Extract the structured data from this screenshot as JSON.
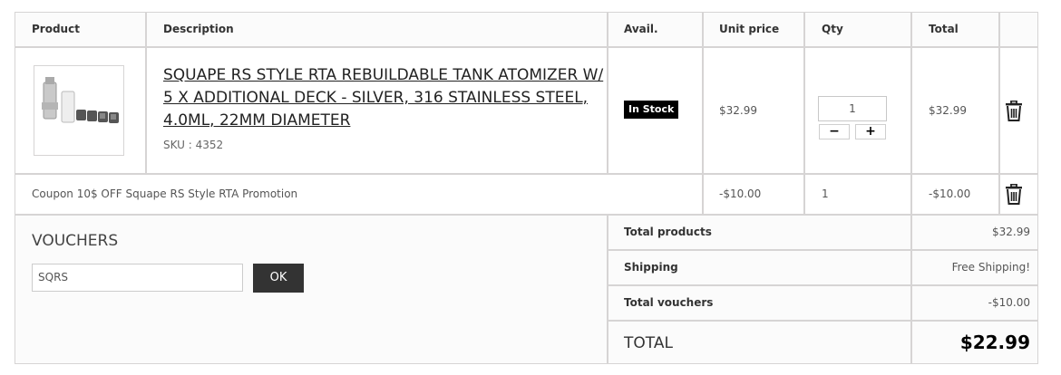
{
  "headers": {
    "product": "Product",
    "description": "Description",
    "avail": "Avail.",
    "unit_price": "Unit price",
    "qty": "Qty",
    "total": "Total"
  },
  "item": {
    "name": "SQUAPE RS STYLE RTA REBUILDABLE TANK ATOMIZER W/ 5 X ADDITIONAL DECK - SILVER, 316 STAINLESS STEEL, 4.0ML, 22MM DIAMETER",
    "sku": "SKU : 4352",
    "availability": "In Stock",
    "unit_price": "$32.99",
    "qty": "1",
    "total": "$32.99",
    "minus": "−",
    "plus": "+"
  },
  "coupon": {
    "label": "Coupon 10$ OFF Squape RS Style RTA Promotion",
    "unit_price": "-$10.00",
    "qty": "1",
    "total": "-$10.00"
  },
  "vouchers": {
    "title": "VOUCHERS",
    "input_value": "SQRS",
    "ok_label": "OK"
  },
  "summary": {
    "total_products_label": "Total products",
    "total_products_value": "$32.99",
    "shipping_label": "Shipping",
    "shipping_value": "Free Shipping!",
    "total_vouchers_label": "Total vouchers",
    "total_vouchers_value": "-$10.00",
    "total_label": "TOTAL",
    "total_value": "$22.99"
  },
  "icons": {
    "delete": "trash-icon"
  },
  "colors": {
    "border": "#d6d4d4",
    "stock_badge": "#000000",
    "ok_button": "#333333",
    "section_bg": "#fbfbfb"
  }
}
